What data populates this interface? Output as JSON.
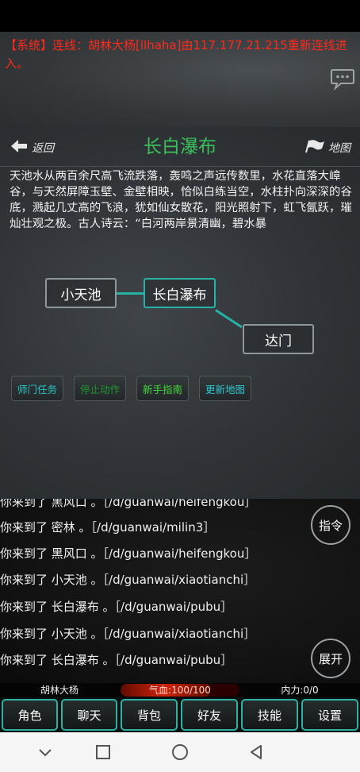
{
  "system": {
    "message": "【系统】连线：胡林大杨[llhaha]由117.177.21.215重新连线进入。"
  },
  "room": {
    "back_label": "返回",
    "title": "长白瀑布",
    "map_label": "地图",
    "description": "天池水从两百余尺高飞流跌落，轰鸣之声远传数里，水花直落大嶂谷，与天然屏障玉壁、金壁相映，恰似白练当空，水柱扑向深深的谷底，溅起几丈高的飞浪，犹如仙女散花，阳光照射下，虹飞氤跃，璀灿壮观之极。古人诗云：“白河两岸景清幽，碧水暴"
  },
  "map": {
    "nodes": [
      "小天池",
      "长白瀑布",
      "达门"
    ]
  },
  "commands": [
    {
      "label": "师门任务",
      "color": "#27c4c4"
    },
    {
      "label": "停止动作",
      "color": "#1f9a2f"
    },
    {
      "label": "新手指南",
      "color": "#45d93b"
    },
    {
      "label": "更新地图",
      "color": "#30c8d0"
    }
  ],
  "log": [
    "你来到了 黑风口 。［/d/guanwai/heifengkou］",
    "你来到了 密林 。［/d/guanwai/milin3］",
    "你来到了 黑风口 。［/d/guanwai/heifengkou］",
    "你来到了 小天池 。［/d/guanwai/xiaotianchi］",
    "你来到了 长白瀑布 。［/d/guanwai/pubu］",
    "你来到了 小天池 。［/d/guanwai/xiaotianchi］",
    "你来到了 长白瀑布 。［/d/guanwai/pubu］"
  ],
  "round_buttons": {
    "command": "指令",
    "expand": "展开"
  },
  "stats": {
    "player_name": "胡林大杨",
    "hp_text": "气血:100/100",
    "hp_fraction": 0.74,
    "mp_text": "内力:0/0"
  },
  "menu": [
    "角色",
    "聊天",
    "背包",
    "好友",
    "技能",
    "设置"
  ],
  "icons": {
    "chat": "chat-bubble-icon",
    "back": "back-arrow-icon",
    "map": "flag-icon",
    "nav": [
      "nav-down-icon",
      "nav-home-square-icon",
      "nav-circle-icon",
      "nav-back-triangle-icon"
    ]
  },
  "colors": {
    "system_red": "#ff2a1a",
    "title_green": "#39c05a",
    "accent_teal": "#26b2a4",
    "hp_red": "#d2230c"
  }
}
